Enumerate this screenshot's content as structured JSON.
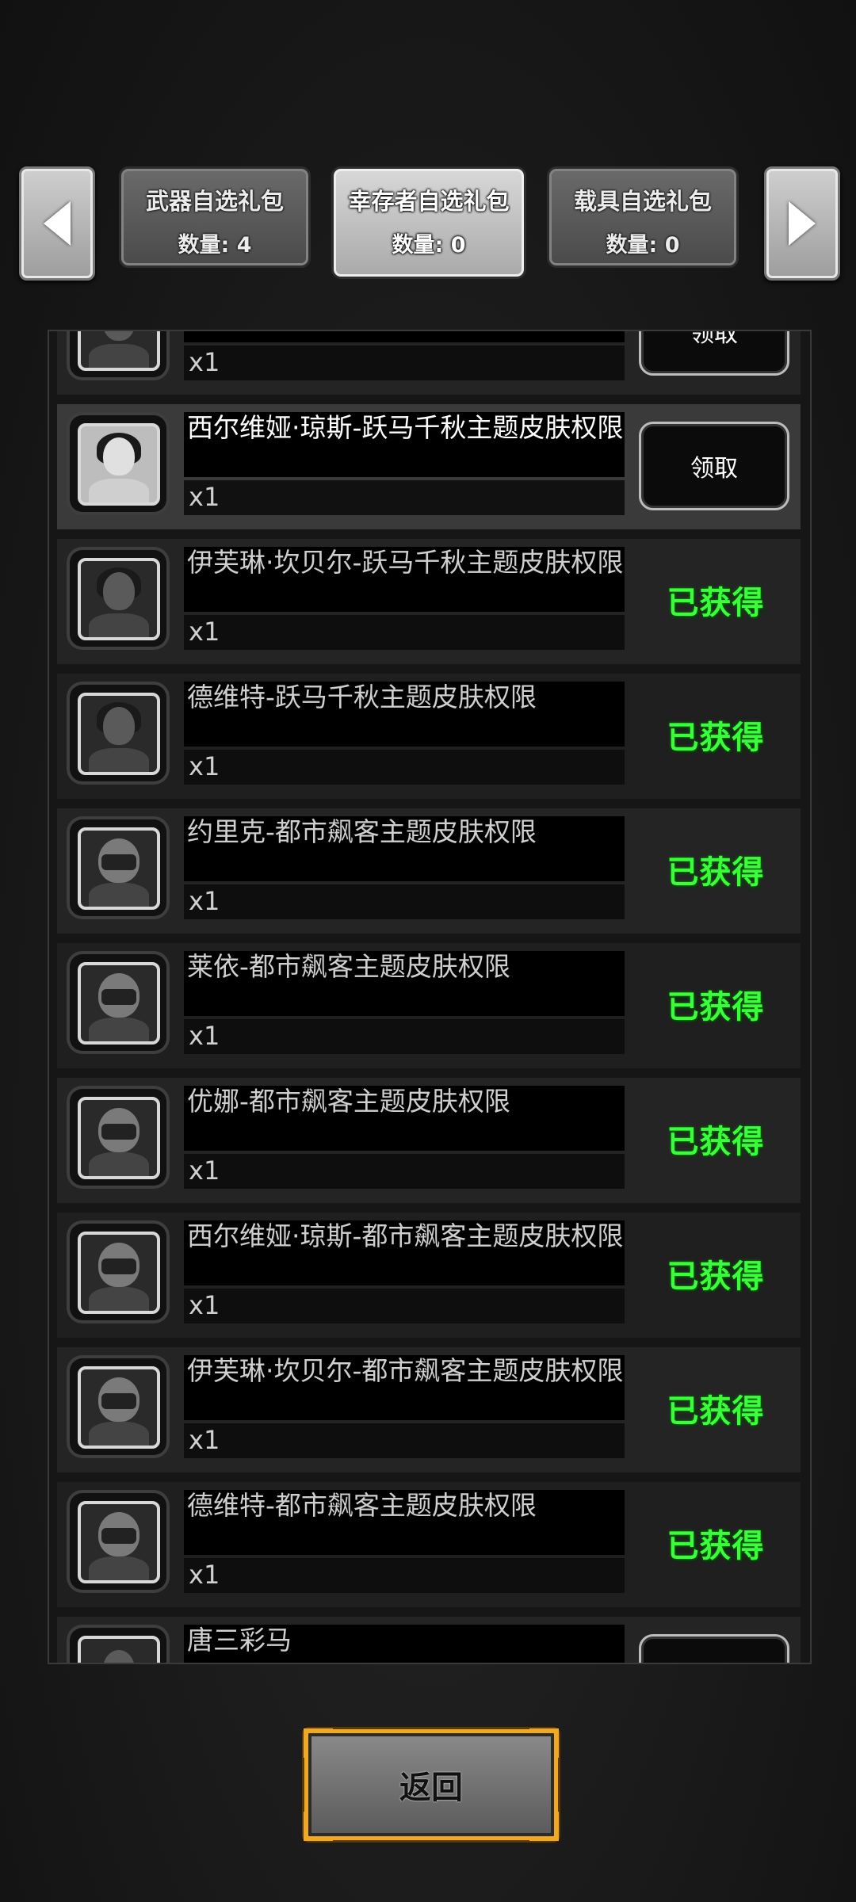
{
  "tabs": [
    {
      "title": "武器自选礼包",
      "count": "数量: 4",
      "active": false
    },
    {
      "title": "幸存者自选礼包",
      "count": "数量: 0",
      "active": true
    },
    {
      "title": "载具自选礼包",
      "count": "数量: 0",
      "active": false
    }
  ],
  "nav": {
    "prev_icon": "arrow-left-icon",
    "next_icon": "arrow-right-icon"
  },
  "rows": [
    {
      "name": "",
      "qty": "x1",
      "status": "claim",
      "action": "领取"
    },
    {
      "name": "西尔维娅·琼斯-跃马千秋主题皮肤权限",
      "qty": "x1",
      "status": "claim",
      "action": "领取"
    },
    {
      "name": "伊芙琳·坎贝尔-跃马千秋主题皮肤权限",
      "qty": "x1",
      "status": "obtained",
      "action": "已获得"
    },
    {
      "name": "德维特-跃马千秋主题皮肤权限",
      "qty": "x1",
      "status": "obtained",
      "action": "已获得"
    },
    {
      "name": "约里克-都市飙客主题皮肤权限",
      "qty": "x1",
      "status": "obtained",
      "action": "已获得"
    },
    {
      "name": "莱依-都市飙客主题皮肤权限",
      "qty": "x1",
      "status": "obtained",
      "action": "已获得"
    },
    {
      "name": "优娜-都市飙客主题皮肤权限",
      "qty": "x1",
      "status": "obtained",
      "action": "已获得"
    },
    {
      "name": "西尔维娅·琼斯-都市飙客主题皮肤权限",
      "qty": "x1",
      "status": "obtained",
      "action": "已获得"
    },
    {
      "name": "伊芙琳·坎贝尔-都市飙客主题皮肤权限",
      "qty": "x1",
      "status": "obtained",
      "action": "已获得"
    },
    {
      "name": "德维特-都市飙客主题皮肤权限",
      "qty": "x1",
      "status": "obtained",
      "action": "已获得"
    },
    {
      "name": "唐三彩马",
      "qty": "",
      "status": "claim",
      "action": ""
    }
  ],
  "footer": {
    "back_label": "返回"
  },
  "colors": {
    "obtained": "#39ff3a",
    "accent_gold": "#f1a922"
  }
}
